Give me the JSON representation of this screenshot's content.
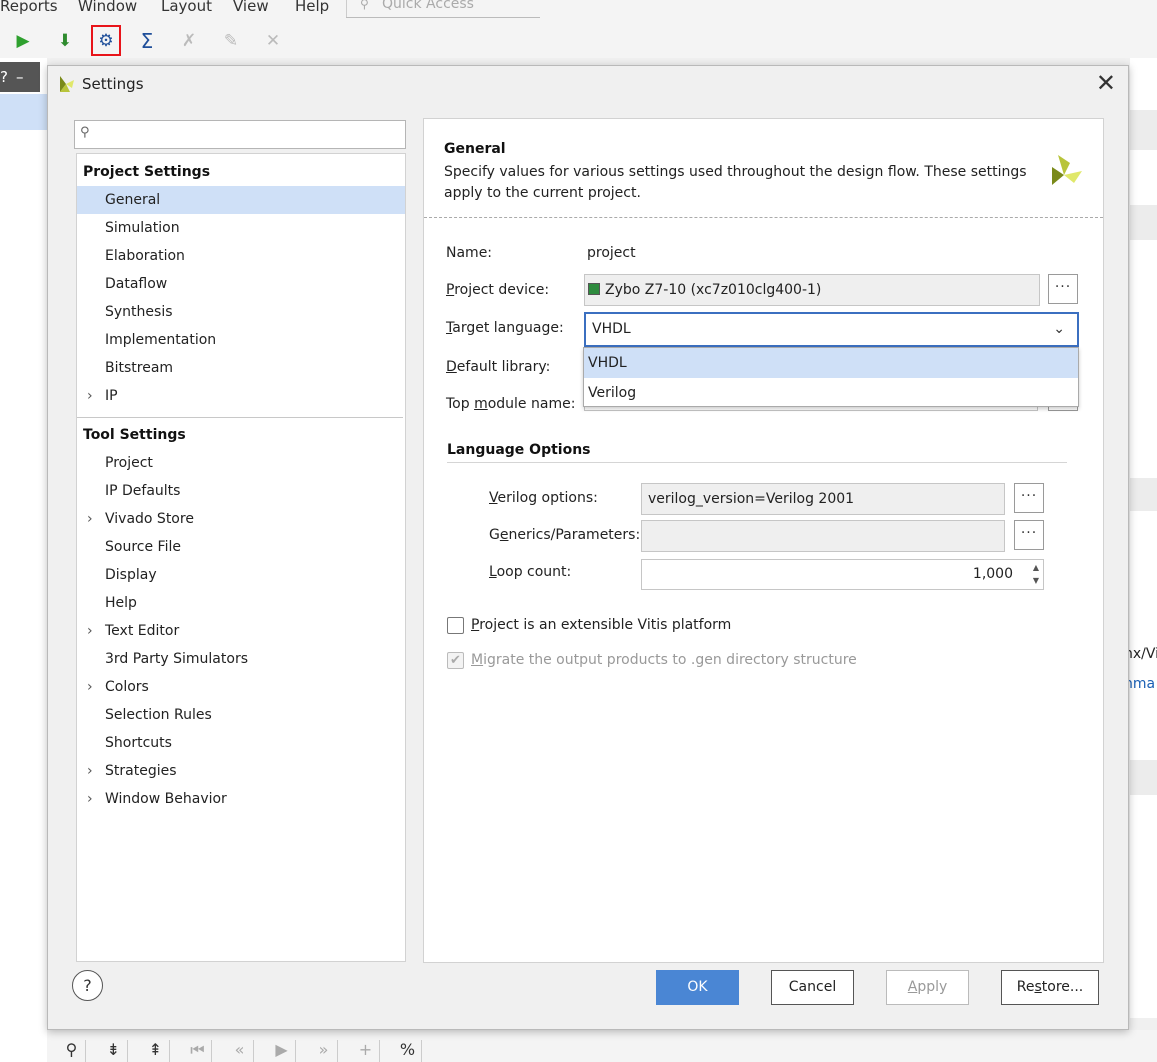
{
  "menubar": {
    "items": [
      "Reports",
      "Window",
      "Layout",
      "View",
      "Help"
    ],
    "quick_access_placeholder": "Quick Access"
  },
  "background": {
    "right_text_1": "nx/Vi",
    "right_text_2": "nma"
  },
  "dialog": {
    "title": "Settings",
    "close_symbol": "✕"
  },
  "tree": {
    "project_settings_header": "Project Settings",
    "project_items": [
      "General",
      "Simulation",
      "Elaboration",
      "Dataflow",
      "Synthesis",
      "Implementation",
      "Bitstream",
      "IP"
    ],
    "tool_settings_header": "Tool Settings",
    "tool_items": [
      "Project",
      "IP Defaults",
      "Vivado Store",
      "Source File",
      "Display",
      "Help",
      "Text Editor",
      "3rd Party Simulators",
      "Colors",
      "Selection Rules",
      "Shortcuts",
      "Strategies",
      "Window Behavior"
    ]
  },
  "general": {
    "title": "General",
    "description": "Specify values for various settings used throughout the design flow. These settings apply to the current project.",
    "name_label": "Name:",
    "name_value": "project",
    "device_label": "Project device:",
    "device_value": "Zybo Z7-10 (xc7z010clg400-1)",
    "target_language_label": "Target language:",
    "target_language_value": "VHDL",
    "language_options": [
      "VHDL",
      "Verilog"
    ],
    "default_library_label": "Default library:",
    "top_module_label": "Top module name:",
    "language_options_title": "Language Options",
    "verilog_options_label": "Verilog options:",
    "verilog_options_value": "verilog_version=Verilog 2001",
    "generics_label": "Generics/Parameters:",
    "loop_count_label": "Loop count:",
    "loop_count_value": "1,000",
    "extensible_label": "Project is an extensible Vitis platform",
    "migrate_label": "Migrate the output products to .gen directory structure",
    "ellipsis": "···"
  },
  "buttons": {
    "help": "?",
    "ok": "OK",
    "cancel": "Cancel",
    "apply": "Apply",
    "restore": "Restore..."
  },
  "colors": {
    "accent": "#4a86d4",
    "selection": "#cfe0f7",
    "highlight_border": "#e8141a"
  }
}
